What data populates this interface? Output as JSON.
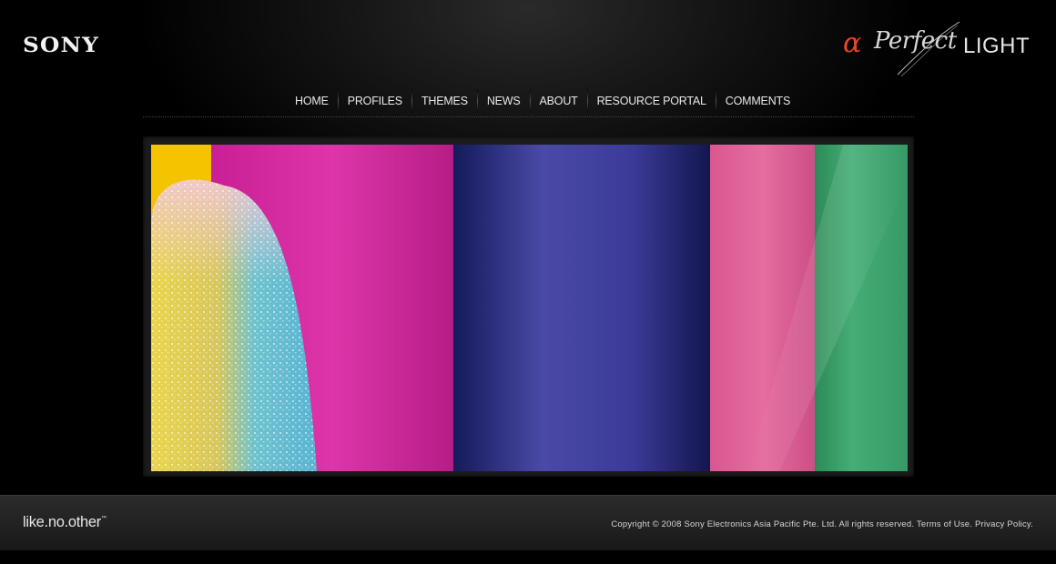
{
  "header": {
    "brand": "SONY",
    "campaign": {
      "alpha": "α",
      "script": "Perfect",
      "word": "LIGHT"
    }
  },
  "nav": {
    "items": [
      {
        "label": "HOME"
      },
      {
        "label": "PROFILES"
      },
      {
        "label": "THEMES"
      },
      {
        "label": "NEWS"
      },
      {
        "label": "ABOUT"
      },
      {
        "label": "RESOURCE PORTAL"
      },
      {
        "label": "COMMENTS"
      }
    ]
  },
  "hero": {
    "stripes": [
      "#f5c400",
      "#d92fa8",
      "#3a3a9e",
      "#e0679b",
      "#3fa870"
    ]
  },
  "footer": {
    "tagline": "like.no.other",
    "tagline_mark": "™",
    "copyright": "Copyright © 2008 Sony Electronics Asia Pacific Pte. Ltd. All rights reserved.",
    "terms": "Terms of Use.",
    "privacy": "Privacy Policy."
  },
  "colors": {
    "accent": "#e8452a",
    "background": "#000000"
  }
}
